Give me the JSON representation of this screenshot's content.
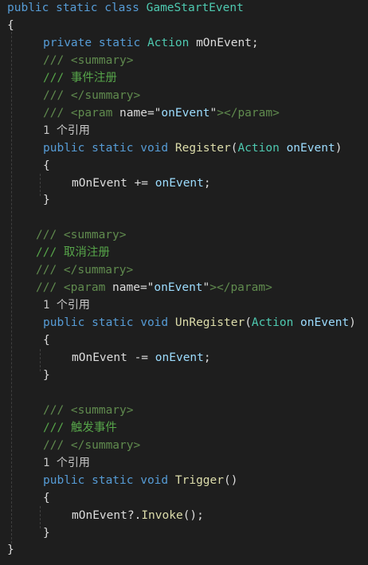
{
  "colors": {
    "background": "#1e1e1e",
    "keyword": "#569cd6",
    "type": "#4ec9b0",
    "method": "#dcdcaa",
    "parameter": "#9cdcfe",
    "plain": "#dcdcdc",
    "comment": "#57a64a",
    "xml_doc_tag": "#608b4e",
    "reference_lens": "#c8c8c8"
  },
  "code": [
    {
      "line": 1,
      "indent": 0,
      "tokens": [
        {
          "t": "public static class ",
          "c": "kw"
        },
        {
          "t": "GameStartEvent",
          "c": "ty"
        }
      ]
    },
    {
      "line": 2,
      "indent": 0,
      "tokens": [
        {
          "t": "{",
          "c": "tx"
        }
      ]
    },
    {
      "line": 3,
      "indent": 45,
      "tokens": [
        {
          "t": "private static ",
          "c": "kw"
        },
        {
          "t": "Action",
          "c": "ty"
        },
        {
          "t": " mOnEvent;",
          "c": "tx"
        }
      ]
    },
    {
      "line": 4,
      "indent": 45,
      "tokens": [
        {
          "t": "/// ",
          "c": "xd"
        },
        {
          "t": "<summary>",
          "c": "xd"
        }
      ]
    },
    {
      "line": 5,
      "indent": 45,
      "tokens": [
        {
          "t": "/// 事件注册",
          "c": "cm"
        }
      ]
    },
    {
      "line": 6,
      "indent": 45,
      "tokens": [
        {
          "t": "/// ",
          "c": "xd"
        },
        {
          "t": "</summary>",
          "c": "xd"
        }
      ]
    },
    {
      "line": 7,
      "indent": 45,
      "tokens": [
        {
          "t": "/// ",
          "c": "xd"
        },
        {
          "t": "<param ",
          "c": "xd"
        },
        {
          "t": "name=\"",
          "c": "tx"
        },
        {
          "t": "onEvent",
          "c": "pm"
        },
        {
          "t": "\"",
          "c": "tx"
        },
        {
          "t": "></param>",
          "c": "xd"
        }
      ]
    },
    {
      "line": 8,
      "indent": 45,
      "tokens": [
        {
          "t": "1 个引用",
          "c": "ref"
        }
      ]
    },
    {
      "line": 9,
      "indent": 45,
      "tokens": [
        {
          "t": "public static void ",
          "c": "kw"
        },
        {
          "t": "Register",
          "c": "fn"
        },
        {
          "t": "(",
          "c": "tx"
        },
        {
          "t": "Action",
          "c": "ty"
        },
        {
          "t": " ",
          "c": "tx"
        },
        {
          "t": "onEvent",
          "c": "pm"
        },
        {
          "t": ")",
          "c": "tx"
        }
      ]
    },
    {
      "line": 10,
      "indent": 45,
      "tokens": [
        {
          "t": "{",
          "c": "tx"
        }
      ]
    },
    {
      "line": 11,
      "indent": 81,
      "tokens": [
        {
          "t": "mOnEvent ",
          "c": "tx"
        },
        {
          "t": "+=",
          "c": "tx"
        },
        {
          "t": " ",
          "c": "tx"
        },
        {
          "t": "onEvent",
          "c": "pm"
        },
        {
          "t": ";",
          "c": "tx"
        }
      ]
    },
    {
      "line": 12,
      "indent": 45,
      "tokens": [
        {
          "t": "}",
          "c": "tx"
        }
      ]
    },
    {
      "line": 13,
      "indent": 0,
      "tokens": []
    },
    {
      "line": 14,
      "indent": 36,
      "tokens": [
        {
          "t": "/// ",
          "c": "xd"
        },
        {
          "t": "<summary>",
          "c": "xd"
        }
      ]
    },
    {
      "line": 15,
      "indent": 36,
      "tokens": [
        {
          "t": "/// 取消注册",
          "c": "cm"
        }
      ]
    },
    {
      "line": 16,
      "indent": 36,
      "tokens": [
        {
          "t": "/// ",
          "c": "xd"
        },
        {
          "t": "</summary>",
          "c": "xd"
        }
      ]
    },
    {
      "line": 17,
      "indent": 36,
      "tokens": [
        {
          "t": "/// ",
          "c": "xd"
        },
        {
          "t": "<param ",
          "c": "xd"
        },
        {
          "t": "name=\"",
          "c": "tx"
        },
        {
          "t": "onEvent",
          "c": "pm"
        },
        {
          "t": "\"",
          "c": "tx"
        },
        {
          "t": "></param>",
          "c": "xd"
        }
      ]
    },
    {
      "line": 18,
      "indent": 45,
      "tokens": [
        {
          "t": "1 个引用",
          "c": "ref"
        }
      ]
    },
    {
      "line": 19,
      "indent": 45,
      "tokens": [
        {
          "t": "public static void ",
          "c": "kw"
        },
        {
          "t": "UnRegister",
          "c": "fn"
        },
        {
          "t": "(",
          "c": "tx"
        },
        {
          "t": "Action",
          "c": "ty"
        },
        {
          "t": " ",
          "c": "tx"
        },
        {
          "t": "onEvent",
          "c": "pm"
        },
        {
          "t": ")",
          "c": "tx"
        }
      ]
    },
    {
      "line": 20,
      "indent": 45,
      "tokens": [
        {
          "t": "{",
          "c": "tx"
        }
      ]
    },
    {
      "line": 21,
      "indent": 81,
      "tokens": [
        {
          "t": "mOnEvent ",
          "c": "tx"
        },
        {
          "t": "-=",
          "c": "tx"
        },
        {
          "t": " ",
          "c": "tx"
        },
        {
          "t": "onEvent",
          "c": "pm"
        },
        {
          "t": ";",
          "c": "tx"
        }
      ]
    },
    {
      "line": 22,
      "indent": 45,
      "tokens": [
        {
          "t": "}",
          "c": "tx"
        }
      ]
    },
    {
      "line": 23,
      "indent": 0,
      "tokens": []
    },
    {
      "line": 24,
      "indent": 45,
      "tokens": [
        {
          "t": "/// ",
          "c": "xd"
        },
        {
          "t": "<summary>",
          "c": "xd"
        }
      ]
    },
    {
      "line": 25,
      "indent": 45,
      "tokens": [
        {
          "t": "/// 触发事件",
          "c": "cm"
        }
      ]
    },
    {
      "line": 26,
      "indent": 45,
      "tokens": [
        {
          "t": "/// ",
          "c": "xd"
        },
        {
          "t": "</summary>",
          "c": "xd"
        }
      ]
    },
    {
      "line": 27,
      "indent": 45,
      "tokens": [
        {
          "t": "1 个引用",
          "c": "ref"
        }
      ]
    },
    {
      "line": 28,
      "indent": 45,
      "tokens": [
        {
          "t": "public static void ",
          "c": "kw"
        },
        {
          "t": "Trigger",
          "c": "fn"
        },
        {
          "t": "()",
          "c": "tx"
        }
      ]
    },
    {
      "line": 29,
      "indent": 45,
      "tokens": [
        {
          "t": "{",
          "c": "tx"
        }
      ]
    },
    {
      "line": 30,
      "indent": 81,
      "tokens": [
        {
          "t": "mOnEvent?.",
          "c": "tx"
        },
        {
          "t": "Invoke",
          "c": "fn"
        },
        {
          "t": "();",
          "c": "tx"
        }
      ]
    },
    {
      "line": 31,
      "indent": 45,
      "tokens": [
        {
          "t": "}",
          "c": "tx"
        }
      ]
    },
    {
      "line": 32,
      "indent": 0,
      "tokens": [
        {
          "t": "}",
          "c": "tx"
        }
      ]
    }
  ]
}
